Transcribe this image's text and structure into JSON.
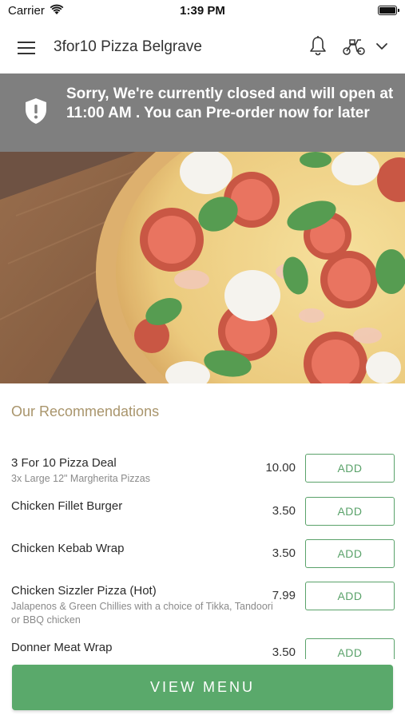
{
  "status_bar": {
    "carrier": "Carrier",
    "time": "1:39 PM"
  },
  "header": {
    "title": "3for10 Pizza Belgrave",
    "icons": [
      "menu-icon",
      "bell-icon",
      "scooter-icon",
      "chevron-down-icon"
    ]
  },
  "banner": {
    "message": "Sorry, We're currently closed and will open at 11:00 AM . You can Pre-order now for later",
    "icon": "shield-alert-icon"
  },
  "recommendations": {
    "title": "Our Recommendations",
    "items": [
      {
        "name": "3 For 10 Pizza Deal",
        "description": "3x Large 12\" Margherita Pizzas",
        "price": "10.00",
        "button": "ADD"
      },
      {
        "name": "Chicken Fillet Burger",
        "description": "",
        "price": "3.50",
        "button": "ADD"
      },
      {
        "name": "Chicken Kebab Wrap",
        "description": "",
        "price": "3.50",
        "button": "ADD"
      },
      {
        "name": "Chicken Sizzler Pizza (Hot)",
        "description": "Jalapenos & Green Chillies with a choice of Tikka, Tandoori or BBQ chicken",
        "price": "7.99",
        "button": "ADD"
      },
      {
        "name": "Donner Meat Wrap",
        "description": "",
        "price": "3.50",
        "button": "ADD"
      }
    ]
  },
  "footer": {
    "view_menu": "VIEW MENU"
  },
  "colors": {
    "accent_green": "#5aa96b",
    "banner_gray": "#7f7f7f",
    "section_title": "#a9956c"
  }
}
